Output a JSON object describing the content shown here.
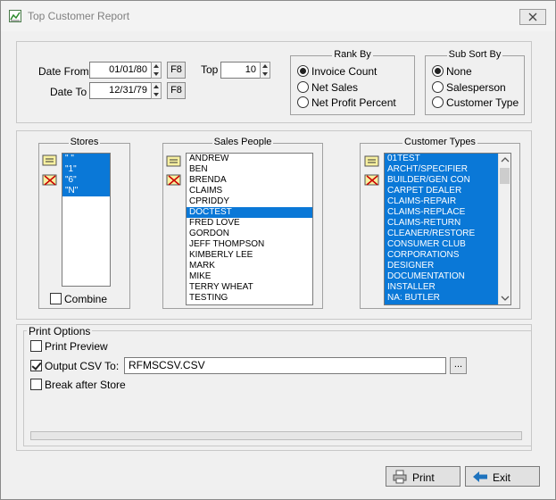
{
  "window": {
    "title": "Top Customer Report"
  },
  "date": {
    "from_label": "Date From",
    "from_value": "01/01/80",
    "from_button": "F8",
    "to_label": "Date To",
    "to_value": "12/31/79",
    "to_button": "F8"
  },
  "top": {
    "label": "Top",
    "value": "10"
  },
  "rank_by": {
    "title": "Rank By",
    "options": [
      "Invoice Count",
      "Net Sales",
      "Net Profit Percent"
    ],
    "selected": "Invoice Count"
  },
  "sub_sort_by": {
    "title": "Sub Sort By",
    "options": [
      "None",
      "Salesperson",
      "Customer Type"
    ],
    "selected": "None"
  },
  "stores": {
    "title": "Stores",
    "items": [
      "\" \"",
      "\"1\"",
      "\"6\"",
      "\"N\""
    ],
    "combine_label": "Combine",
    "combine_checked": false
  },
  "sales_people": {
    "title": "Sales People",
    "items": [
      "ANDREW",
      "BEN",
      "BRENDA",
      "CLAIMS",
      "CPRIDDY",
      "DOCTEST",
      "FRED LOVE",
      "GORDON",
      "JEFF THOMPSON",
      "KIMBERLY LEE",
      "MARK",
      "MIKE",
      "TERRY WHEAT",
      "TESTING"
    ],
    "selected": "DOCTEST"
  },
  "customer_types": {
    "title": "Customer Types",
    "items": [
      "01TEST",
      "ARCHT/SPECIFIER",
      "BUILDER/GEN CON",
      "CARPET DEALER",
      "CLAIMS-REPAIR",
      "CLAIMS-REPLACE",
      "CLAIMS-RETURN",
      "CLEANER/RESTORE",
      "CONSUMER CLUB",
      "CORPORATIONS",
      "DESIGNER",
      "DOCUMENTATION",
      "INSTALLER",
      "NA: BUTLER"
    ]
  },
  "print_options": {
    "title": "Print Options",
    "preview_label": "Print Preview",
    "preview_checked": false,
    "csv_label": "Output CSV To:",
    "csv_checked": true,
    "csv_value": "RFMSCSV.CSV",
    "browse_label": "...",
    "break_label": "Break after Store",
    "break_checked": false
  },
  "footer": {
    "print_label": "Print",
    "exit_label": "Exit"
  },
  "colors": {
    "selection": "#0a78d7",
    "exit_arrow": "#1e73be"
  }
}
